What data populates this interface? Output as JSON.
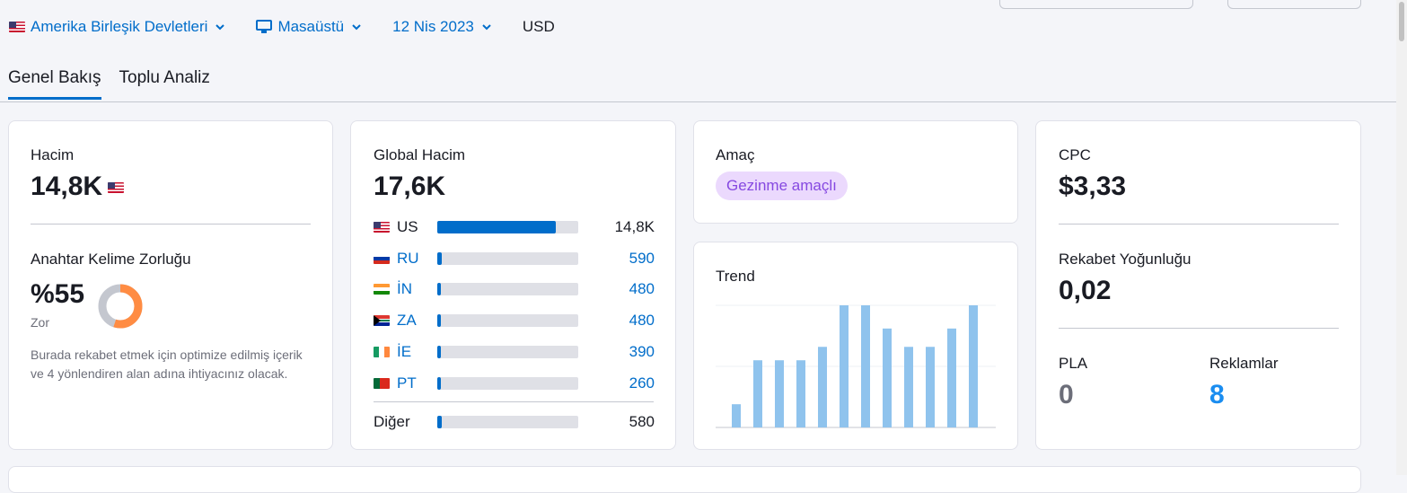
{
  "filters": {
    "country": "Amerika Birleşik Devletleri",
    "device": "Masaüstü",
    "date": "12 Nis 2023",
    "currency": "USD"
  },
  "tabs": [
    {
      "label": "Genel Bakış",
      "active": true
    },
    {
      "label": "Toplu Analiz",
      "active": false
    }
  ],
  "volume": {
    "label": "Hacim",
    "value": "14,8K"
  },
  "kd": {
    "label": "Anahtar Kelime Zorluğu",
    "value": "%55",
    "percent": 55,
    "level": "Zor",
    "description": "Burada rekabet etmek için optimize edilmiş içerik ve 4 yönlendiren alan adına ihtiyacınız olacak."
  },
  "global_volume": {
    "label": "Global Hacim",
    "value": "17,6K",
    "rows": [
      {
        "code": "US",
        "value": "14,8K",
        "share": 0.84,
        "flag": "us"
      },
      {
        "code": "RU",
        "value": "590",
        "share": 0.034,
        "flag": "ru"
      },
      {
        "code": "İN",
        "value": "480",
        "share": 0.027,
        "flag": "in"
      },
      {
        "code": "ZA",
        "value": "480",
        "share": 0.027,
        "flag": "za"
      },
      {
        "code": "İE",
        "value": "390",
        "share": 0.022,
        "flag": "ie"
      },
      {
        "code": "PT",
        "value": "260",
        "share": 0.015,
        "flag": "pt"
      }
    ],
    "other": {
      "code": "Diğer",
      "value": "580",
      "share": 0.033
    }
  },
  "intent": {
    "label": "Amaç",
    "badge": "Gezinme amaçlı"
  },
  "trend": {
    "label": "Trend",
    "values": [
      0.19,
      0.55,
      0.55,
      0.55,
      0.66,
      1.0,
      1.0,
      0.81,
      0.66,
      0.66,
      0.81,
      1.0
    ]
  },
  "cpc": {
    "label": "CPC",
    "value": "$3,33"
  },
  "competition": {
    "label": "Rekabet Yoğunluğu",
    "value": "0,02"
  },
  "pla": {
    "label": "PLA",
    "value": "0"
  },
  "ads": {
    "label": "Reklamlar",
    "value": "8"
  },
  "colors": {
    "accent": "#006dca",
    "trend_bar": "#8fc3ed",
    "kd_orange": "#ff8c43",
    "intent_bg": "#ebd9fd",
    "intent_text": "#8649e1"
  }
}
